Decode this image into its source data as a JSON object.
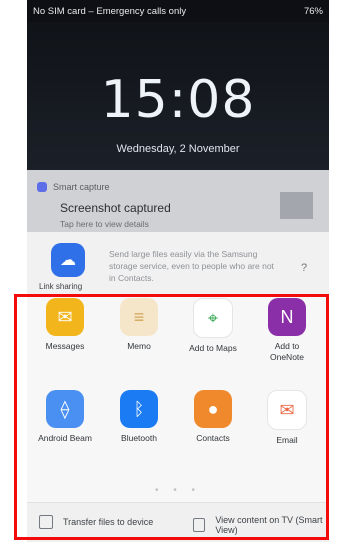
{
  "status_bar": {
    "left": "No SIM card – Emergency calls only",
    "right": "76%"
  },
  "lock_screen": {
    "time": "15:08",
    "date": "Wednesday, 2 November"
  },
  "notification": {
    "app": "Smart capture",
    "title": "Screenshot captured",
    "subtitle": "Tap here to view details"
  },
  "link_sharing": {
    "label": "Link sharing",
    "description": "Send large files easily via the Samsung storage service, even to people who are not in Contacts.",
    "help": "?"
  },
  "share_targets": [
    {
      "label": "Messages",
      "icon": "messages-icon",
      "color": "#f2b51c"
    },
    {
      "label": "Memo",
      "icon": "memo-icon",
      "color": "#f6e6c9"
    },
    {
      "label": "Add to Maps",
      "icon": "maps-icon",
      "color": "#ffffff"
    },
    {
      "label": "Add to OneNote",
      "icon": "onenote-icon",
      "color": "#8a2fa7"
    },
    {
      "label": "Android Beam",
      "icon": "android-beam-icon",
      "color": "#4a8ff2"
    },
    {
      "label": "Bluetooth",
      "icon": "bluetooth-icon",
      "color": "#1b7bf2"
    },
    {
      "label": "Contacts",
      "icon": "contacts-icon",
      "color": "#f0892c"
    },
    {
      "label": "Email",
      "icon": "email-icon",
      "color": "#ffffff"
    }
  ],
  "pagination": {
    "dots": "• • •"
  },
  "bottom_actions": {
    "transfer": "Transfer files to device",
    "view_tv": "View content on TV (Smart View)"
  }
}
